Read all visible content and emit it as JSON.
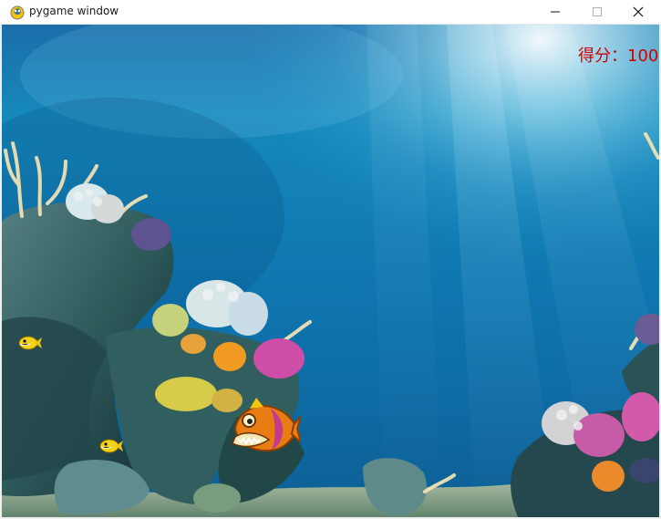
{
  "window": {
    "title": "pygame window",
    "app_icon": "pygame-snake-icon",
    "controls": {
      "minimize_icon": "minimize-icon",
      "maximize_icon": "maximize-icon",
      "close_icon": "close-icon"
    }
  },
  "game": {
    "score_text": "得分：100",
    "score_color": "#d40000",
    "player_fish": "orange-piranha-player",
    "small_fish": [
      "yellow-small-fish",
      "yellow-small-fish"
    ],
    "background": "underwater-coral-reef",
    "water_color": "#1d84b8"
  }
}
